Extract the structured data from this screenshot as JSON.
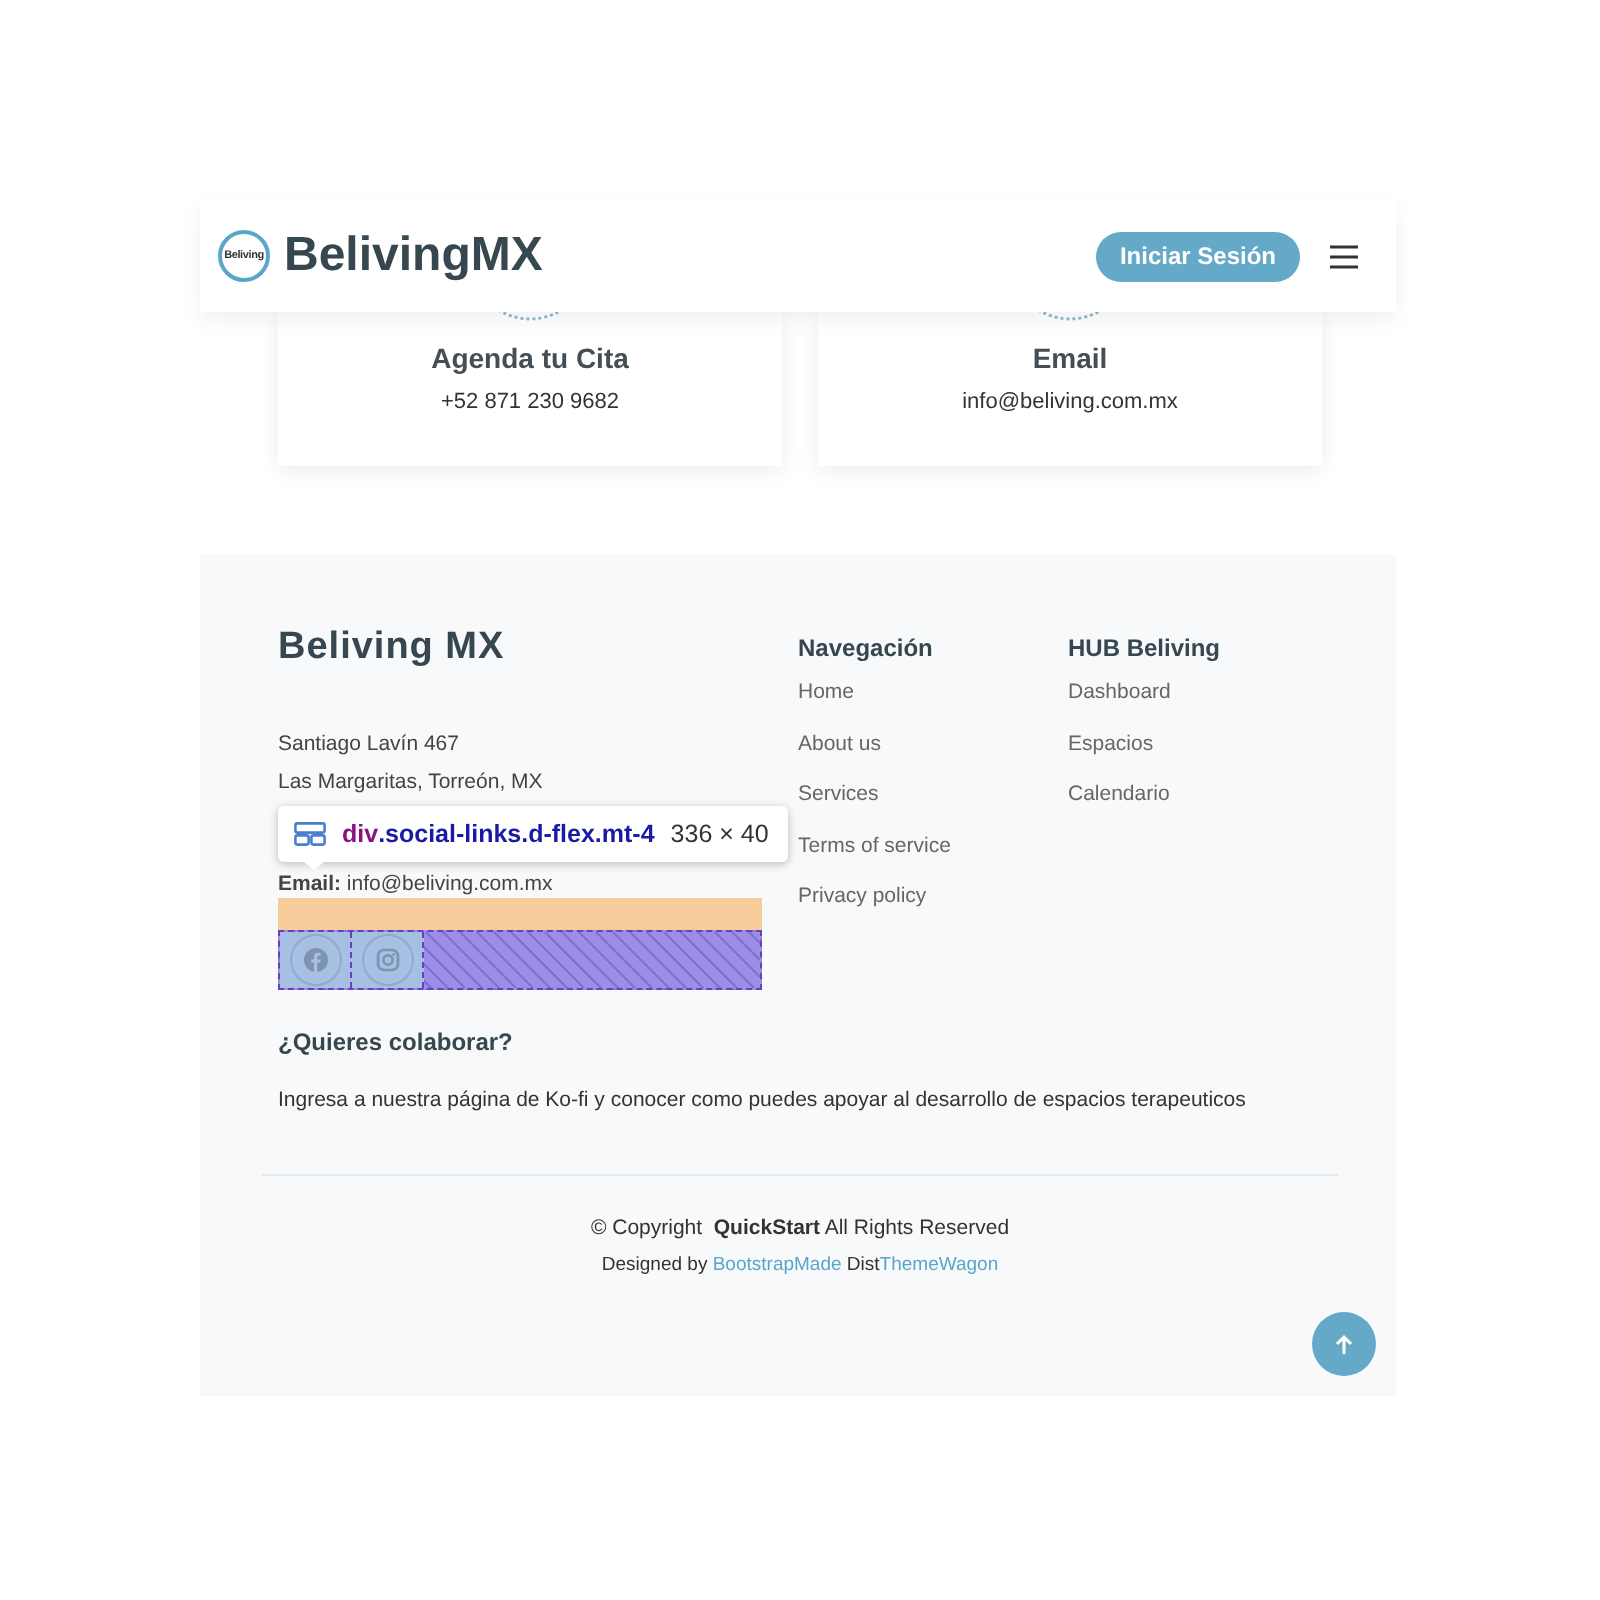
{
  "header": {
    "logo_text": "Beliving",
    "brand": "BelivingMX",
    "login_button": "Iniciar Sesión"
  },
  "contact_cards": [
    {
      "title": "Agenda tu Cita",
      "detail": "+52 871 230 9682"
    },
    {
      "title": "Email",
      "detail": "info@beliving.com.mx"
    }
  ],
  "footer": {
    "title": "Beliving MX",
    "address": [
      "Santiago Lavín 467",
      "Las Margaritas, Torreón, MX"
    ],
    "email": "**Email:** info@beliving.com.mx",
    "social_links": [
      {
        "kind": "facebook"
      },
      {
        "kind": "instagram"
      }
    ],
    "columns": [
      {
        "heading": "Navegación",
        "links": [
          "Home",
          "About us",
          "Services",
          "Terms of service",
          "Privacy policy"
        ]
      },
      {
        "heading": "HUB Beliving",
        "links": [
          "Dashboard",
          "Espacios",
          "Calendario"
        ]
      }
    ],
    "collab_title": "¿Quieres colaborar?",
    "collab_text": "Ingresa a nuestra página de Ko-fi y conocer como puedes apoyar al desarrollo de espacios terapeuticos",
    "copyright": "© Copyright  **QuickStart** All Rights Reserved",
    "credits": {
      "prefix": "Designed by",
      "link_1": "BootstrapMade",
      "middle": "Dist",
      "link_2": "ThemeWagon"
    }
  },
  "inspector_tooltip": {
    "tag": "div",
    "classes": ".social-links.d-flex.mt-4",
    "size": "336 × 40"
  }
}
